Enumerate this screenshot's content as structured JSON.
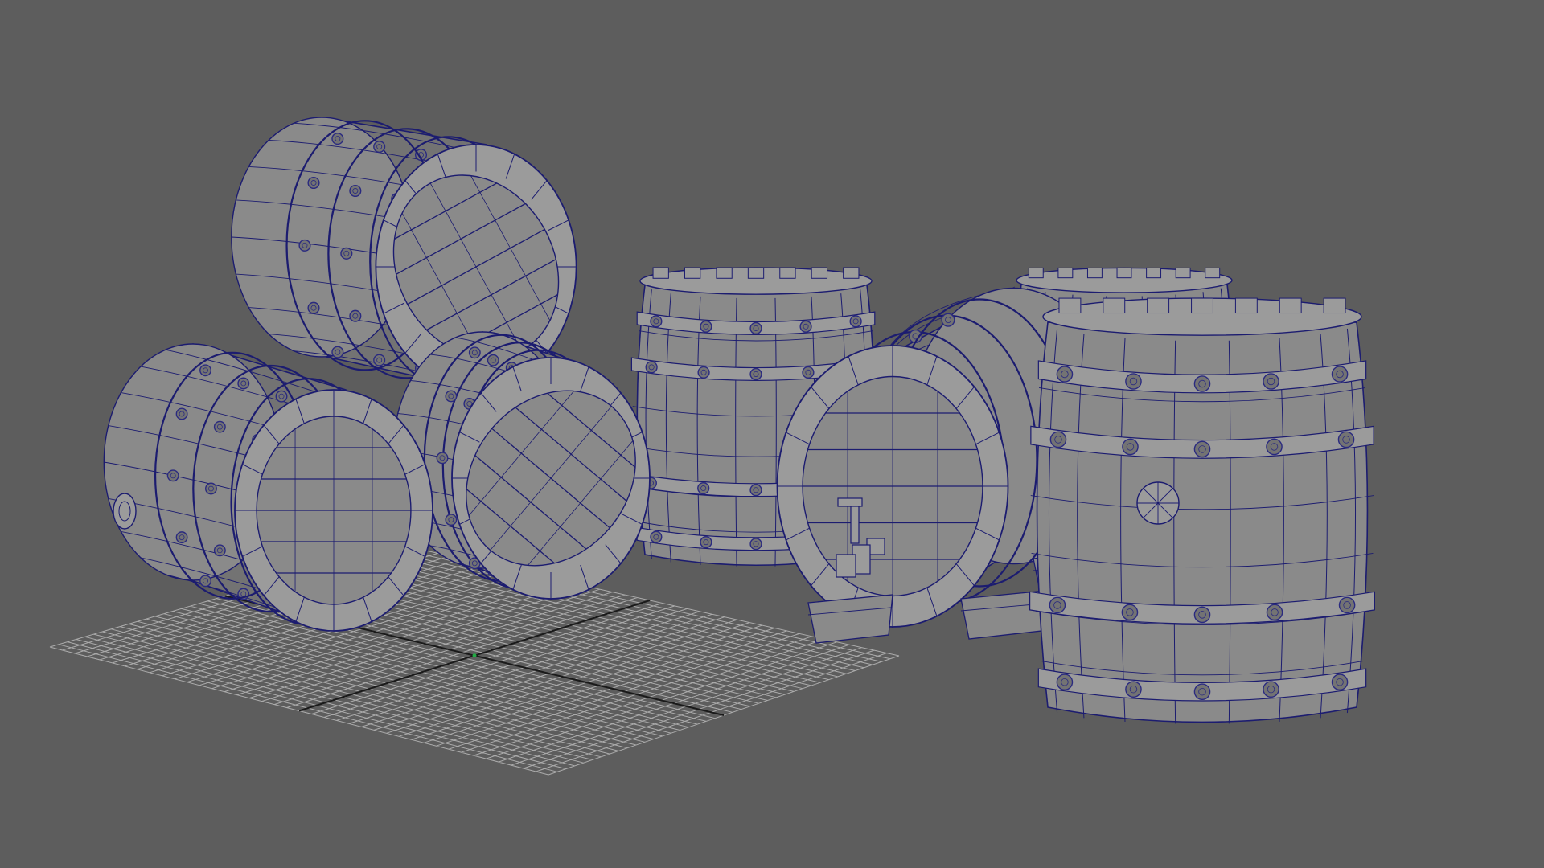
{
  "viewport": {
    "background": "#5d5d5d",
    "grid_color": "#b8b8b8",
    "axis_color": "#1a1a1a",
    "origin_color": "#22aa44",
    "mesh_fill": "#8a8a8a",
    "mesh_shade": "#737373",
    "mesh_light": "#9b9b9b",
    "wire_color": "#1c1c70",
    "rivet_color": "#2a2a80"
  },
  "scene": {
    "objects": [
      {
        "kind": "barrel-lying",
        "name": "barrel-lying-bottom-left"
      },
      {
        "kind": "barrel-lying",
        "name": "barrel-lying-bottom-middle"
      },
      {
        "kind": "barrel-lying",
        "name": "barrel-lying-top"
      },
      {
        "kind": "barrel-standing",
        "name": "barrel-standing-back-center"
      },
      {
        "kind": "barrel-lying-on-stand",
        "name": "barrel-with-tap"
      },
      {
        "kind": "barrel-standing",
        "name": "barrel-standing-back-right"
      },
      {
        "kind": "barrel-standing",
        "name": "barrel-standing-front-right"
      }
    ]
  }
}
